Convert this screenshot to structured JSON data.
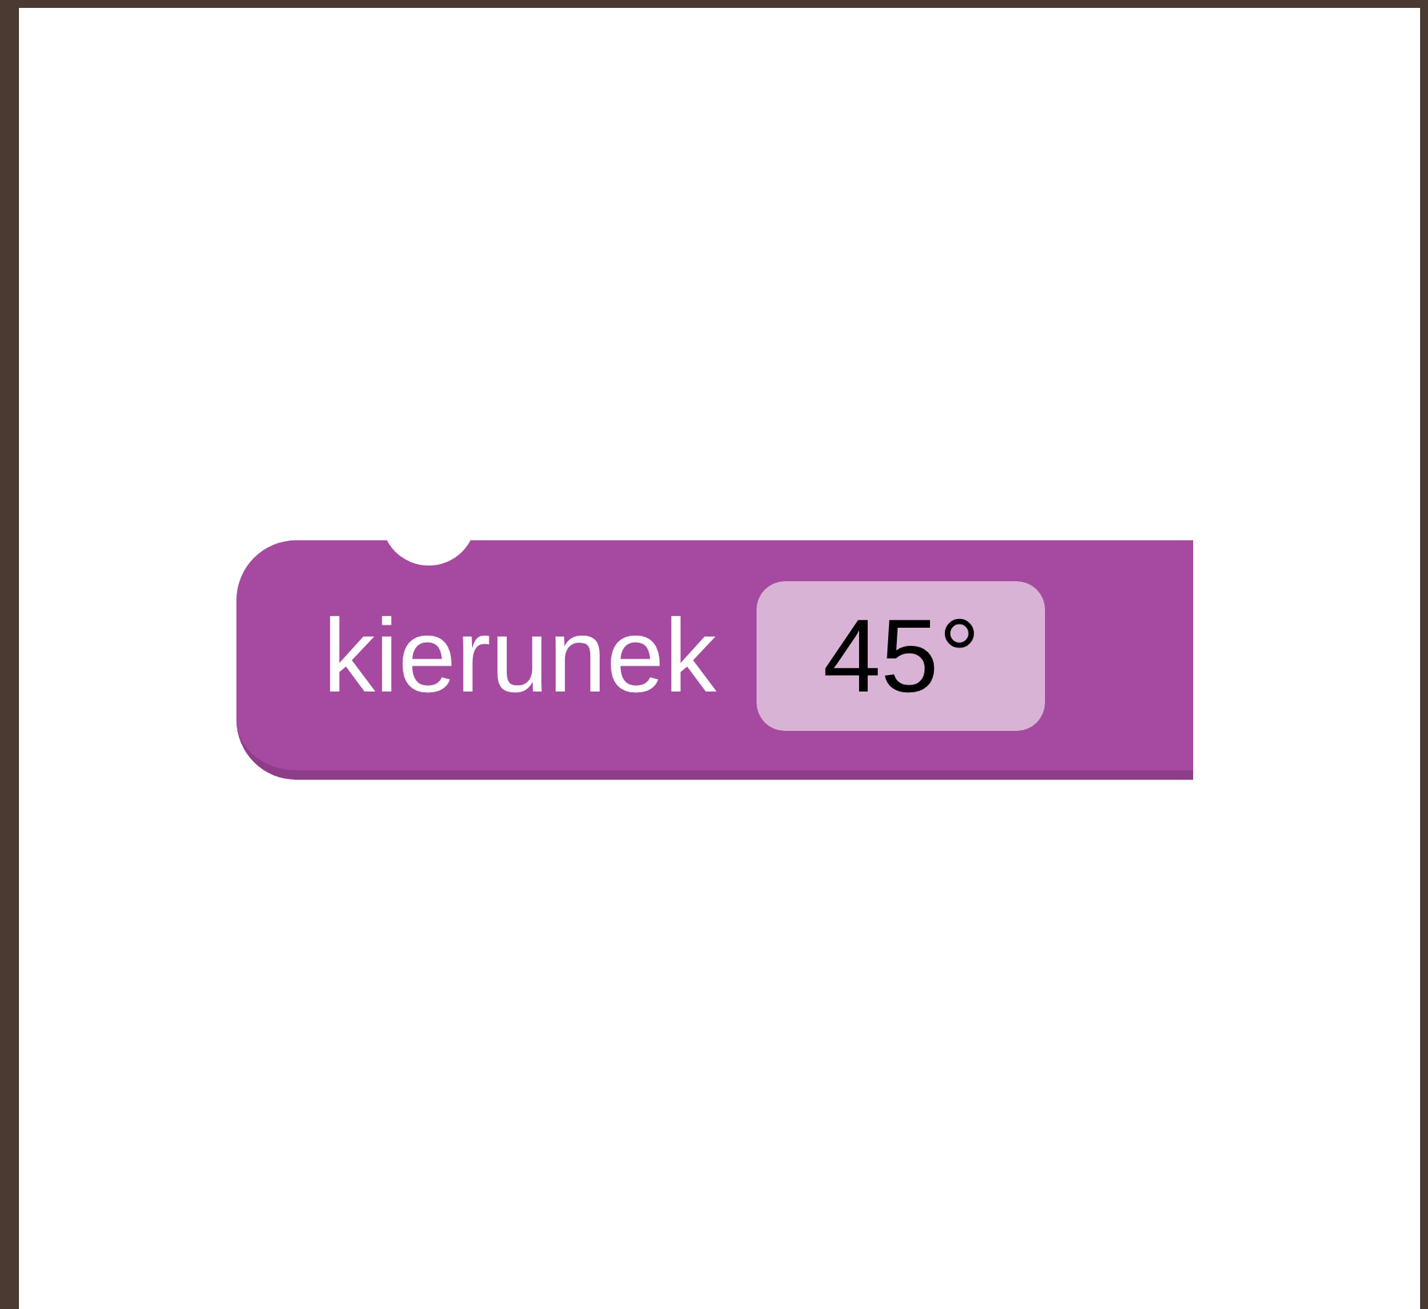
{
  "block": {
    "label": "kierunek",
    "field": {
      "value": "45°"
    }
  }
}
